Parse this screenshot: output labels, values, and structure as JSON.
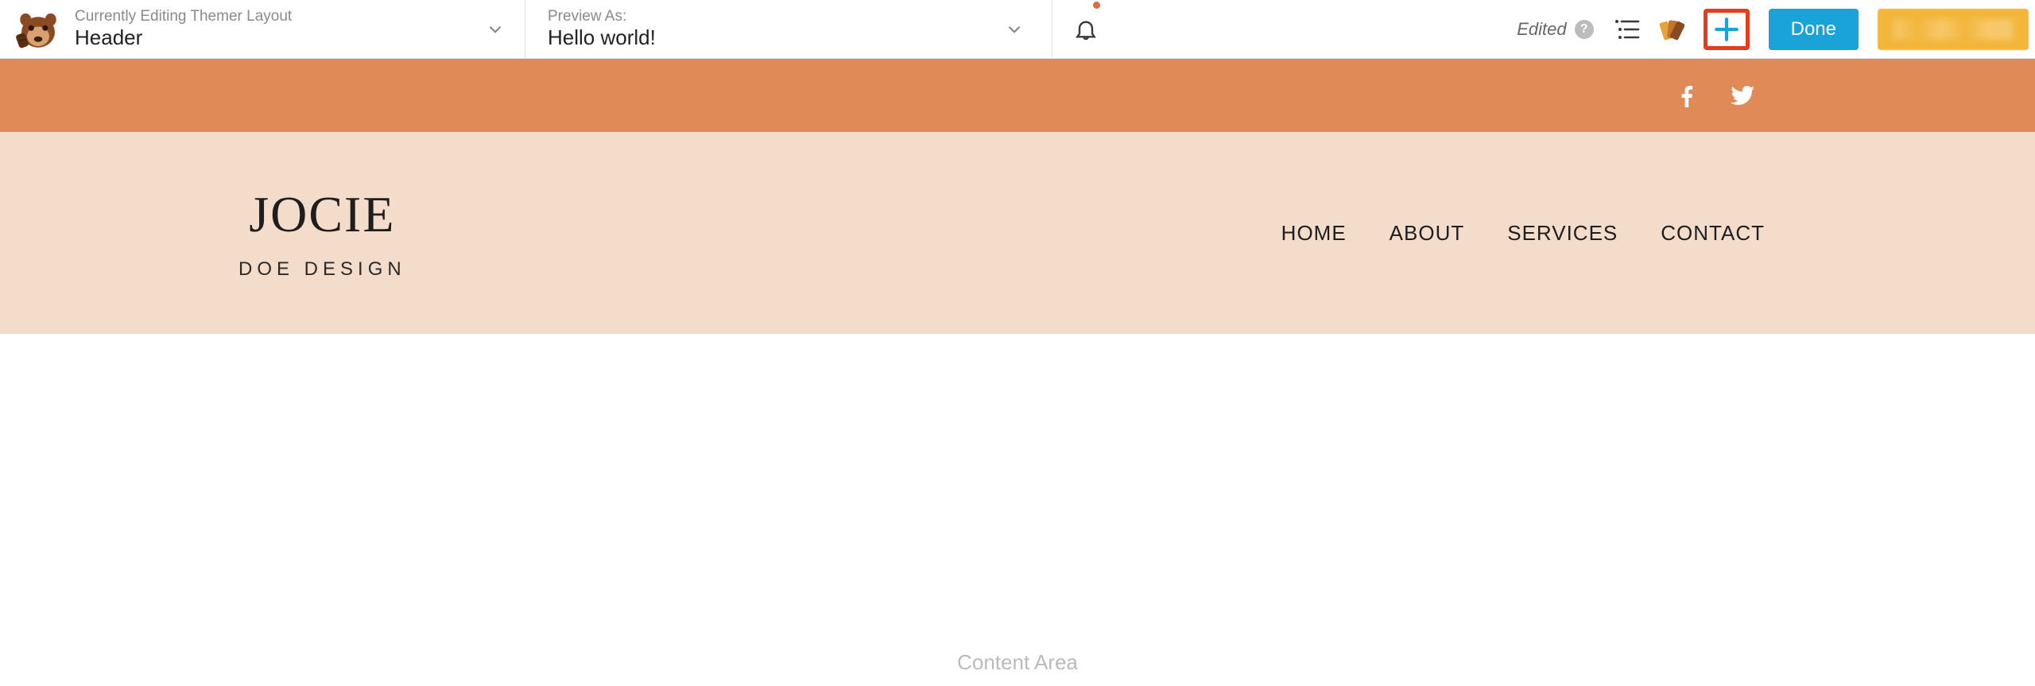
{
  "builder": {
    "editing_label": "Currently Editing Themer Layout",
    "editing_value": "Header",
    "preview_label": "Preview As:",
    "preview_value": "Hello world!",
    "edited_text": "Edited",
    "done_label": "Done"
  },
  "brand": {
    "title": "JOCIE",
    "subtitle": "DOE DESIGN"
  },
  "nav": {
    "items": [
      "HOME",
      "ABOUT",
      "SERVICES",
      "CONTACT"
    ]
  },
  "content": {
    "placeholder": "Content Area"
  },
  "colors": {
    "orange_bar": "#e08a58",
    "header_band": "#f3dcc9",
    "done_button": "#1aa3d9",
    "highlight_border": "#e43c1c",
    "yellow_button": "#f3b63b"
  }
}
